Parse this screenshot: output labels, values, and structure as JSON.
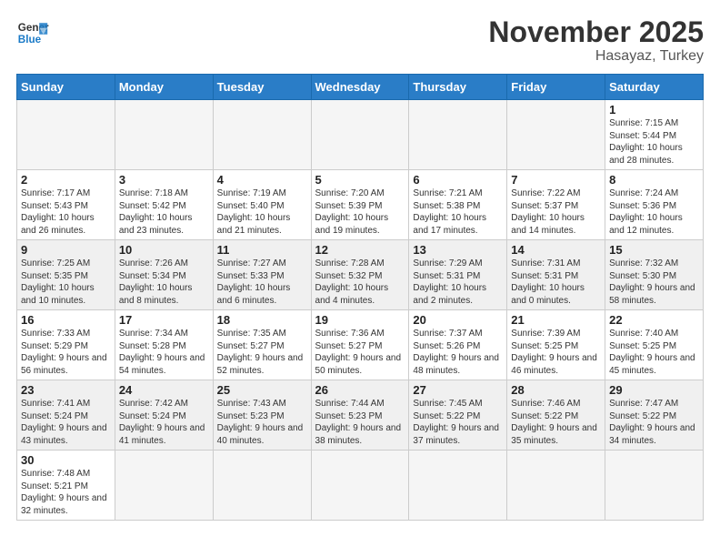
{
  "logo": {
    "text_general": "General",
    "text_blue": "Blue"
  },
  "header": {
    "month": "November 2025",
    "location": "Hasayaz, Turkey"
  },
  "weekdays": [
    "Sunday",
    "Monday",
    "Tuesday",
    "Wednesday",
    "Thursday",
    "Friday",
    "Saturday"
  ],
  "weeks": [
    {
      "shaded": false,
      "days": [
        {
          "num": "",
          "info": ""
        },
        {
          "num": "",
          "info": ""
        },
        {
          "num": "",
          "info": ""
        },
        {
          "num": "",
          "info": ""
        },
        {
          "num": "",
          "info": ""
        },
        {
          "num": "",
          "info": ""
        },
        {
          "num": "1",
          "info": "Sunrise: 7:15 AM\nSunset: 5:44 PM\nDaylight: 10 hours and 28 minutes."
        }
      ]
    },
    {
      "shaded": false,
      "days": [
        {
          "num": "2",
          "info": "Sunrise: 7:17 AM\nSunset: 5:43 PM\nDaylight: 10 hours and 26 minutes."
        },
        {
          "num": "3",
          "info": "Sunrise: 7:18 AM\nSunset: 5:42 PM\nDaylight: 10 hours and 23 minutes."
        },
        {
          "num": "4",
          "info": "Sunrise: 7:19 AM\nSunset: 5:40 PM\nDaylight: 10 hours and 21 minutes."
        },
        {
          "num": "5",
          "info": "Sunrise: 7:20 AM\nSunset: 5:39 PM\nDaylight: 10 hours and 19 minutes."
        },
        {
          "num": "6",
          "info": "Sunrise: 7:21 AM\nSunset: 5:38 PM\nDaylight: 10 hours and 17 minutes."
        },
        {
          "num": "7",
          "info": "Sunrise: 7:22 AM\nSunset: 5:37 PM\nDaylight: 10 hours and 14 minutes."
        },
        {
          "num": "8",
          "info": "Sunrise: 7:24 AM\nSunset: 5:36 PM\nDaylight: 10 hours and 12 minutes."
        }
      ]
    },
    {
      "shaded": true,
      "days": [
        {
          "num": "9",
          "info": "Sunrise: 7:25 AM\nSunset: 5:35 PM\nDaylight: 10 hours and 10 minutes."
        },
        {
          "num": "10",
          "info": "Sunrise: 7:26 AM\nSunset: 5:34 PM\nDaylight: 10 hours and 8 minutes."
        },
        {
          "num": "11",
          "info": "Sunrise: 7:27 AM\nSunset: 5:33 PM\nDaylight: 10 hours and 6 minutes."
        },
        {
          "num": "12",
          "info": "Sunrise: 7:28 AM\nSunset: 5:32 PM\nDaylight: 10 hours and 4 minutes."
        },
        {
          "num": "13",
          "info": "Sunrise: 7:29 AM\nSunset: 5:31 PM\nDaylight: 10 hours and 2 minutes."
        },
        {
          "num": "14",
          "info": "Sunrise: 7:31 AM\nSunset: 5:31 PM\nDaylight: 10 hours and 0 minutes."
        },
        {
          "num": "15",
          "info": "Sunrise: 7:32 AM\nSunset: 5:30 PM\nDaylight: 9 hours and 58 minutes."
        }
      ]
    },
    {
      "shaded": false,
      "days": [
        {
          "num": "16",
          "info": "Sunrise: 7:33 AM\nSunset: 5:29 PM\nDaylight: 9 hours and 56 minutes."
        },
        {
          "num": "17",
          "info": "Sunrise: 7:34 AM\nSunset: 5:28 PM\nDaylight: 9 hours and 54 minutes."
        },
        {
          "num": "18",
          "info": "Sunrise: 7:35 AM\nSunset: 5:27 PM\nDaylight: 9 hours and 52 minutes."
        },
        {
          "num": "19",
          "info": "Sunrise: 7:36 AM\nSunset: 5:27 PM\nDaylight: 9 hours and 50 minutes."
        },
        {
          "num": "20",
          "info": "Sunrise: 7:37 AM\nSunset: 5:26 PM\nDaylight: 9 hours and 48 minutes."
        },
        {
          "num": "21",
          "info": "Sunrise: 7:39 AM\nSunset: 5:25 PM\nDaylight: 9 hours and 46 minutes."
        },
        {
          "num": "22",
          "info": "Sunrise: 7:40 AM\nSunset: 5:25 PM\nDaylight: 9 hours and 45 minutes."
        }
      ]
    },
    {
      "shaded": true,
      "days": [
        {
          "num": "23",
          "info": "Sunrise: 7:41 AM\nSunset: 5:24 PM\nDaylight: 9 hours and 43 minutes."
        },
        {
          "num": "24",
          "info": "Sunrise: 7:42 AM\nSunset: 5:24 PM\nDaylight: 9 hours and 41 minutes."
        },
        {
          "num": "25",
          "info": "Sunrise: 7:43 AM\nSunset: 5:23 PM\nDaylight: 9 hours and 40 minutes."
        },
        {
          "num": "26",
          "info": "Sunrise: 7:44 AM\nSunset: 5:23 PM\nDaylight: 9 hours and 38 minutes."
        },
        {
          "num": "27",
          "info": "Sunrise: 7:45 AM\nSunset: 5:22 PM\nDaylight: 9 hours and 37 minutes."
        },
        {
          "num": "28",
          "info": "Sunrise: 7:46 AM\nSunset: 5:22 PM\nDaylight: 9 hours and 35 minutes."
        },
        {
          "num": "29",
          "info": "Sunrise: 7:47 AM\nSunset: 5:22 PM\nDaylight: 9 hours and 34 minutes."
        }
      ]
    },
    {
      "shaded": false,
      "days": [
        {
          "num": "30",
          "info": "Sunrise: 7:48 AM\nSunset: 5:21 PM\nDaylight: 9 hours and 32 minutes."
        },
        {
          "num": "",
          "info": ""
        },
        {
          "num": "",
          "info": ""
        },
        {
          "num": "",
          "info": ""
        },
        {
          "num": "",
          "info": ""
        },
        {
          "num": "",
          "info": ""
        },
        {
          "num": "",
          "info": ""
        }
      ]
    }
  ]
}
